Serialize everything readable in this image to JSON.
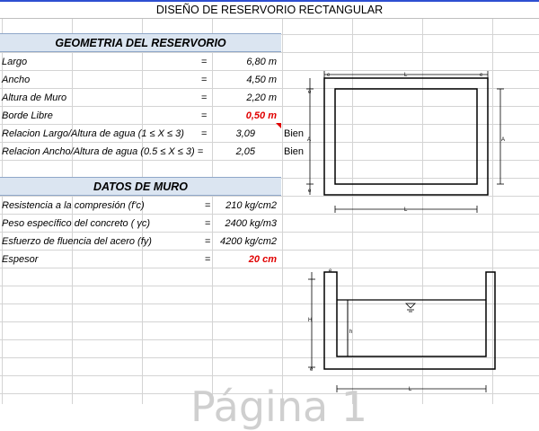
{
  "title": "DISEÑO DE RESERVORIO RECTANGULAR",
  "geometry": {
    "header": "GEOMETRIA DEL RESERVORIO",
    "rows": [
      {
        "label": "Largo",
        "eq": "=",
        "value": "6,80 m",
        "note": ""
      },
      {
        "label": "Ancho",
        "eq": "=",
        "value": "4,50 m",
        "note": ""
      },
      {
        "label": "Altura de Muro",
        "eq": "=",
        "value": "2,20 m",
        "note": ""
      },
      {
        "label": "Borde Libre",
        "eq": "=",
        "value": "0,50 m",
        "note": ""
      },
      {
        "label": "Relacion Largo/Altura de agua   (1  ≤ X ≤ 3)",
        "eq": "=",
        "value": "3,09",
        "note": "Bien"
      },
      {
        "label": "Relacion Ancho/Altura de agua   (0.5  ≤ X ≤ 3) =",
        "eq": "",
        "value": "2,05",
        "note": "Bien"
      }
    ]
  },
  "wall": {
    "header": "DATOS DE MURO",
    "rows": [
      {
        "label": "Resistencia a la compresión (f'c)",
        "eq": "=",
        "value": "210 kg/cm2"
      },
      {
        "label": "Peso específico del concreto ( γc)",
        "eq": "=",
        "value": "2400 kg/m3"
      },
      {
        "label": "Esfuerzo de fluencia del acero (fy)",
        "eq": "=",
        "value": "4200 kg/cm2"
      },
      {
        "label": "Espesor",
        "eq": "=",
        "value": "20 cm"
      }
    ]
  },
  "plan_diagram": {
    "top_label": "L",
    "bottom_label": "L",
    "left_label": "A",
    "right_label": "A",
    "corner_labels": [
      "e",
      "e",
      "e",
      "e"
    ]
  },
  "section_diagram": {
    "bottom_label": "L",
    "height_label": "H",
    "water_label": "h",
    "wall_label": "e",
    "base_label": "e",
    "water_icon": "water-level-icon"
  },
  "watermark": "Página 1",
  "colors": {
    "band_fill": "#dbe5f1",
    "alert_red": "#e00000",
    "top_accent": "#2e4fd1"
  }
}
